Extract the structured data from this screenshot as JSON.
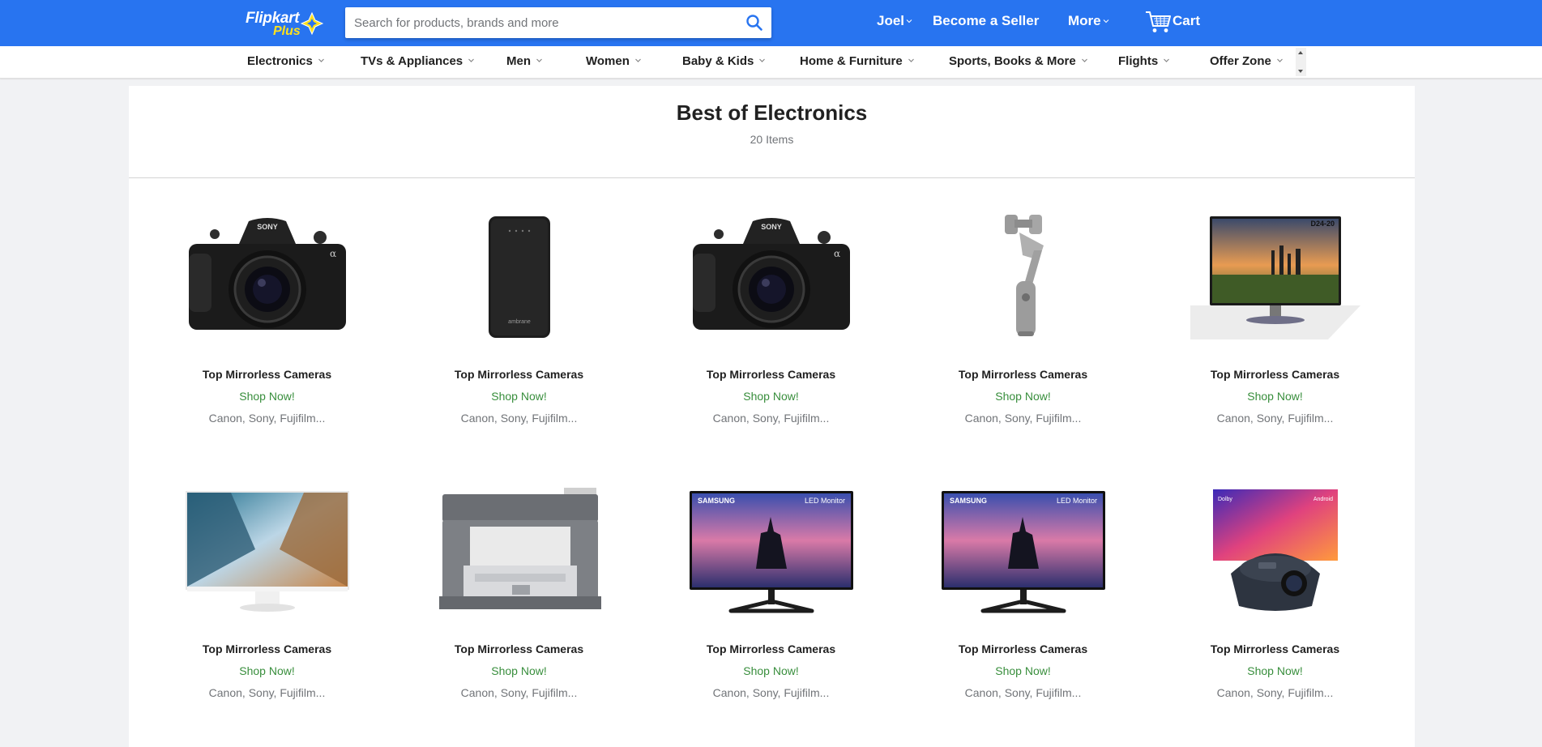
{
  "header": {
    "logo_main": "Flipkart",
    "logo_sub": "Plus",
    "search_placeholder": "Search for products, brands and more",
    "user_label": "Joel",
    "seller_label": "Become a Seller",
    "more_label": "More",
    "cart_label": "Cart",
    "brand_color": "#2874f0",
    "plus_color": "#ffe11b"
  },
  "categories": [
    {
      "label": "Electronics"
    },
    {
      "label": "TVs & Appliances"
    },
    {
      "label": "Men"
    },
    {
      "label": "Women"
    },
    {
      "label": "Baby & Kids"
    },
    {
      "label": "Home & Furniture"
    },
    {
      "label": "Sports, Books & More"
    },
    {
      "label": "Flights"
    },
    {
      "label": "Offer Zone"
    }
  ],
  "section": {
    "title": "Best of Electronics",
    "count": "20 Items"
  },
  "products": [
    {
      "image": "mirrorless-camera",
      "title": "Top Mirrorless Cameras",
      "offer": "Shop Now!",
      "brands": "Canon, Sony, Fujifilm..."
    },
    {
      "image": "power-bank",
      "title": "Top Mirrorless Cameras",
      "offer": "Shop Now!",
      "brands": "Canon, Sony, Fujifilm..."
    },
    {
      "image": "mirrorless-camera",
      "title": "Top Mirrorless Cameras",
      "offer": "Shop Now!",
      "brands": "Canon, Sony, Fujifilm..."
    },
    {
      "image": "gimbal-stabilizer",
      "title": "Top Mirrorless Cameras",
      "offer": "Shop Now!",
      "brands": "Canon, Sony, Fujifilm..."
    },
    {
      "image": "monitor-d24",
      "title": "Top Mirrorless Cameras",
      "offer": "Shop Now!",
      "brands": "Canon, Sony, Fujifilm..."
    },
    {
      "image": "monitor-white",
      "title": "Top Mirrorless Cameras",
      "offer": "Shop Now!",
      "brands": "Canon, Sony, Fujifilm..."
    },
    {
      "image": "laser-printer",
      "title": "Top Mirrorless Cameras",
      "offer": "Shop Now!",
      "brands": "Canon, Sony, Fujifilm..."
    },
    {
      "image": "samsung-monitor",
      "title": "Top Mirrorless Cameras",
      "offer": "Shop Now!",
      "brands": "Canon, Sony, Fujifilm..."
    },
    {
      "image": "samsung-monitor",
      "title": "Top Mirrorless Cameras",
      "offer": "Shop Now!",
      "brands": "Canon, Sony, Fujifilm..."
    },
    {
      "image": "projector",
      "title": "Top Mirrorless Cameras",
      "offer": "Shop Now!",
      "brands": "Canon, Sony, Fujifilm..."
    }
  ],
  "image_text": {
    "camera_brand": "SONY",
    "powerbank_brand": "ambrane",
    "monitor_model": "D24-20",
    "samsung_brand": "SAMSUNG",
    "samsung_model": "LED Monitor",
    "projector_logos": [
      "Dolby",
      "Android"
    ]
  }
}
